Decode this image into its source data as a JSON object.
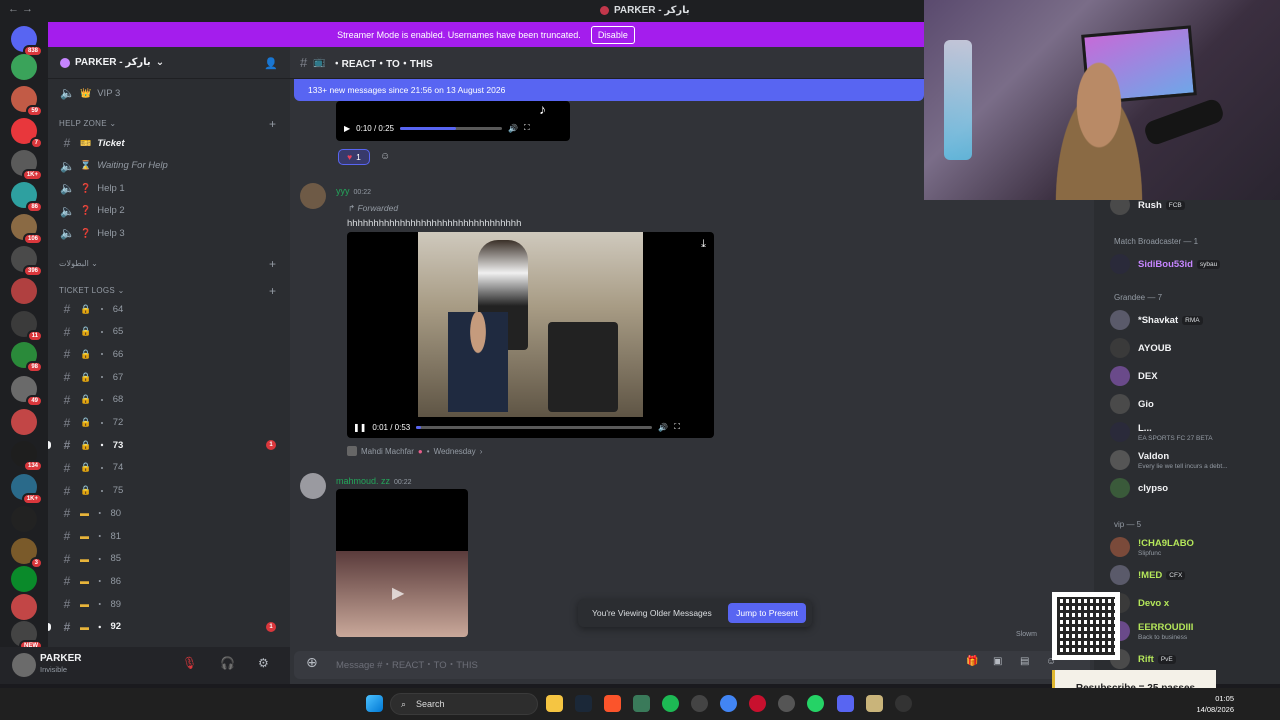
{
  "window": {
    "title": "PARKER - باركر",
    "nav": "←  →"
  },
  "banner": {
    "text": "Streamer Mode is enabled. Usernames have been truncated.",
    "button": "Disable"
  },
  "rail": {
    "badges": [
      "838",
      "",
      "59",
      "7",
      "1K+",
      "86",
      "106",
      "396",
      "",
      "11",
      "98",
      "49",
      "",
      "134",
      "1K+",
      "",
      "3",
      "",
      "",
      "NEW"
    ]
  },
  "server": {
    "name": "PARKER - باركر"
  },
  "channels": {
    "vip": "VIP 3",
    "help_zone_label": "HELP ZONE",
    "help": [
      {
        "label": "Ticket"
      },
      {
        "label": "Waiting For Help"
      },
      {
        "label": "Help 1"
      },
      {
        "label": "Help 2"
      },
      {
        "label": "Help 3"
      }
    ],
    "arabic_category": "البطولات",
    "ticket_logs_label": "TICKET LOGS",
    "logs": [
      {
        "label": "64"
      },
      {
        "label": "65"
      },
      {
        "label": "66"
      },
      {
        "label": "67"
      },
      {
        "label": "68"
      },
      {
        "label": "72"
      },
      {
        "label": "73",
        "badge": "1"
      },
      {
        "label": "74"
      },
      {
        "label": "75"
      },
      {
        "label": "80"
      },
      {
        "label": "81"
      },
      {
        "label": "85"
      },
      {
        "label": "86"
      },
      {
        "label": "89"
      },
      {
        "label": "92",
        "badge": "1"
      }
    ]
  },
  "user": {
    "name": "PARKER",
    "status": "Invisible"
  },
  "channel_header": {
    "name": "・REACT・TO・THIS"
  },
  "new_messages": "133+ new messages since 21:56 on 13 August 2026",
  "top_video": {
    "time": "0:10 / 0:25",
    "progress": 0.55
  },
  "reaction": {
    "count": "1"
  },
  "message1": {
    "author": "yyy",
    "time": "00:22",
    "forwarded": "Forwarded",
    "text": "hhhhhhhhhhhhhhhhhhhhhhhhhhhhhhhhh",
    "video_time": "0:01 / 0:53",
    "progress": 0.02,
    "source_name": "Mahdi Machfar",
    "source_date": "Wednesday"
  },
  "message2": {
    "author": "mahmoud. zz",
    "time": "00:22"
  },
  "jump": {
    "text": "You're Viewing Older Messages",
    "button": "Jump to Present"
  },
  "composer": {
    "placeholder": "Message #・REACT・TO・THIS",
    "slowmode": "Slowm"
  },
  "members": {
    "top": {
      "name": "Rush",
      "tag": "FCB"
    },
    "group1": "Match Broadcaster — 1",
    "g1": [
      {
        "name": "SidiBou53id",
        "tag": "sybau"
      }
    ],
    "group2": "Grandee — 7",
    "g2": [
      {
        "name": "*Shavkat",
        "tag": "RMA"
      },
      {
        "name": "AYOUB"
      },
      {
        "name": "DEX"
      },
      {
        "name": "Gio"
      },
      {
        "name": "L...",
        "sub": "EA SPORTS FC 27 BETA"
      },
      {
        "name": "Valdon",
        "sub": "Every lie we tell incurs a debt..."
      },
      {
        "name": "clypso"
      }
    ],
    "group3": "vip — 5",
    "g3": [
      {
        "name": "!CHA9LABO",
        "sub": "Slipfunc"
      },
      {
        "name": "!MED",
        "tag": "CFX"
      },
      {
        "name": "Devo x"
      },
      {
        "name": "EERROUDIII",
        "sub": "Back to business"
      },
      {
        "name": "Rift",
        "tag": "PvE"
      }
    ]
  },
  "overlay": {
    "resub": "Resubscribe = 25 passes"
  },
  "taskbar": {
    "search": "Search",
    "time": "01:05",
    "date": "14/08/2026"
  }
}
